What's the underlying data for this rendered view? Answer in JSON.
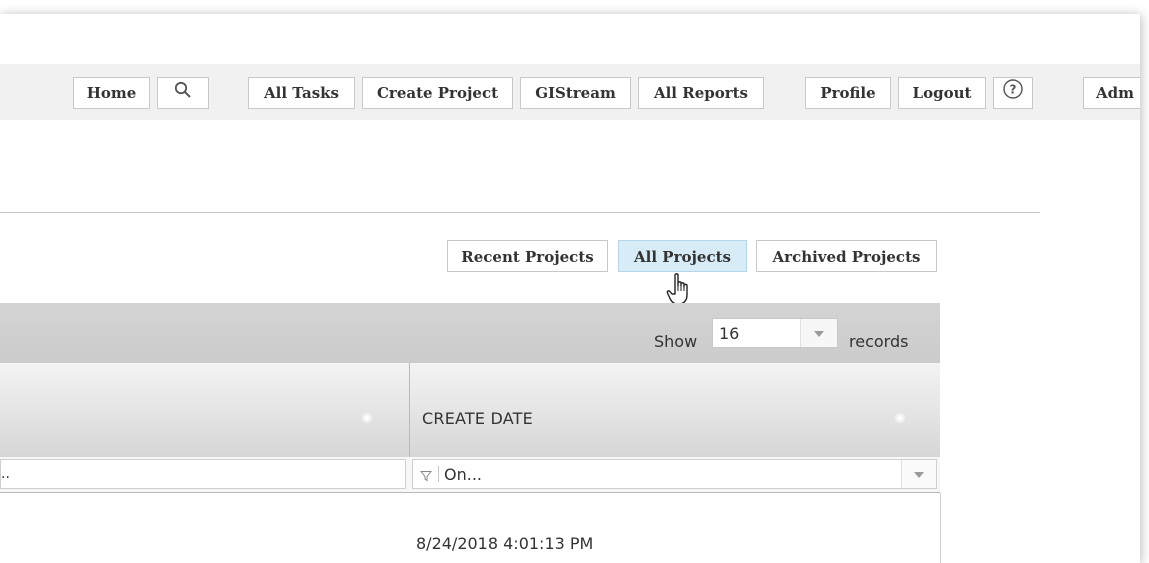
{
  "nav": {
    "home": "Home",
    "search_icon": "search-icon",
    "all_tasks": "All Tasks",
    "create_project": "Create Project",
    "gistream": "GIStream",
    "all_reports": "All Reports",
    "profile": "Profile",
    "logout": "Logout",
    "help_icon": "help-icon",
    "admin": "Adm"
  },
  "project_tabs": {
    "recent": "Recent Projects",
    "all": "All Projects",
    "archived": "Archived Projects",
    "active": "All Projects"
  },
  "pager": {
    "show_label": "Show",
    "page_size": "16",
    "records_label": "records"
  },
  "grid": {
    "columns": [
      {
        "title": ""
      },
      {
        "title": "CREATE DATE"
      }
    ],
    "filters": {
      "left_value": "..",
      "right_value": "On..."
    },
    "rows": [
      {
        "create_date": "8/24/2018 4:01:13 PM"
      }
    ]
  },
  "colors": {
    "active_tab_bg": "#d8ecf8",
    "header_bg": "#d4d4d4",
    "topbar_bg": "#f1f1f1"
  }
}
